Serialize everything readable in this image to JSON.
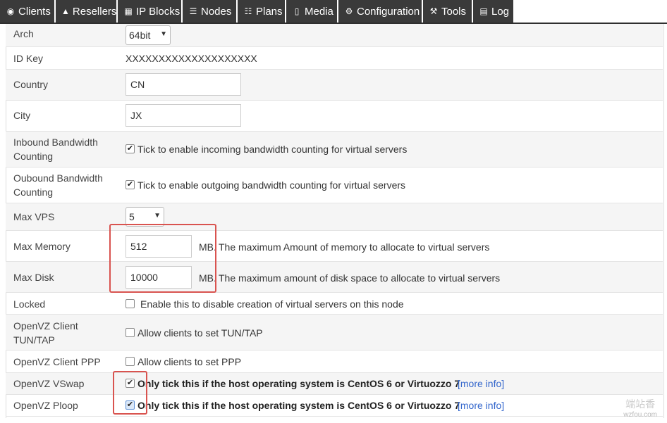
{
  "nav": {
    "tabs": [
      {
        "label": "Clients",
        "icon": "users-icon",
        "glyph": "◉"
      },
      {
        "label": "Resellers",
        "icon": "user-icon",
        "glyph": "▲"
      },
      {
        "label": "IP Blocks",
        "icon": "grid-icon",
        "glyph": "▦"
      },
      {
        "label": "Nodes",
        "icon": "server-icon",
        "glyph": "☰"
      },
      {
        "label": "Plans",
        "icon": "list-icon",
        "glyph": "☷"
      },
      {
        "label": "Media",
        "icon": "file-icon",
        "glyph": "▯"
      },
      {
        "label": "Configuration",
        "icon": "gear-icon",
        "glyph": "⚙"
      },
      {
        "label": "Tools",
        "icon": "wrench-icon",
        "glyph": "⚒"
      },
      {
        "label": "Log",
        "icon": "table-icon",
        "glyph": "▤"
      }
    ]
  },
  "form": {
    "arch": {
      "label": "Arch",
      "value": "64bit"
    },
    "id_key": {
      "label": "ID Key",
      "value": "XXXXXXXXXXXXXXXXXXXX"
    },
    "country": {
      "label": "Country",
      "value": "CN"
    },
    "city": {
      "label": "City",
      "value": "JX"
    },
    "inbound": {
      "label_1": "Inbound Bandwidth",
      "label_2": "Counting",
      "checked": true,
      "text": "Tick to enable incoming bandwidth counting for virtual servers"
    },
    "outbound": {
      "label_1": "Oubound Bandwidth",
      "label_2": "Counting",
      "checked": true,
      "text": "Tick to enable outgoing bandwidth counting for virtual servers"
    },
    "max_vps": {
      "label": "Max VPS",
      "value": "5"
    },
    "max_memory": {
      "label": "Max Memory",
      "value": "512",
      "unit": "MB.",
      "text": "The maximum Amount of memory to allocate to virtual servers"
    },
    "max_disk": {
      "label": "Max Disk",
      "value": "10000",
      "unit": "MB.",
      "text": "The maximum amount of disk space to allocate to virtual servers"
    },
    "locked": {
      "label": "Locked",
      "checked": false,
      "text": "Enable this to disable creation of virtual servers on this node"
    },
    "tun_tap": {
      "label_1": "OpenVZ Client",
      "label_2": "TUN/TAP",
      "checked": false,
      "text": "Allow clients to set TUN/TAP"
    },
    "ppp": {
      "label": "OpenVZ Client PPP",
      "checked": false,
      "text": "Allow clients to set PPP"
    },
    "vswap": {
      "label": "OpenVZ VSwap",
      "checked": true,
      "text": "Only tick this if the host operating system is CentOS 6 or Virtuozzo 7",
      "link": "[more info]"
    },
    "ploop": {
      "label": "OpenVZ Ploop",
      "checked": true,
      "text": "Only tick this if the host operating system is CentOS 6 or Virtuozzo 7",
      "link": "[more info]"
    }
  },
  "watermark": {
    "line1": "端站香",
    "line2": "wzfou.com"
  }
}
